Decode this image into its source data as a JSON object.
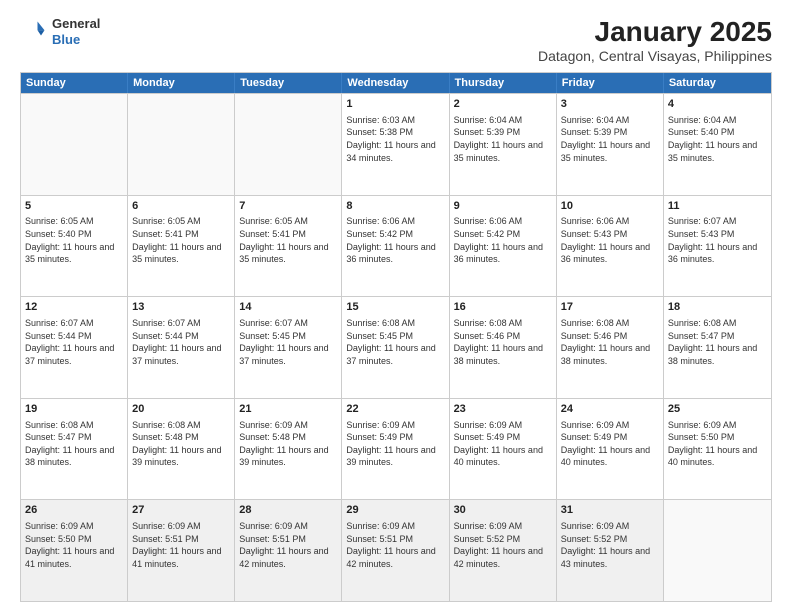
{
  "header": {
    "logo_general": "General",
    "logo_blue": "Blue",
    "title": "January 2025",
    "location": "Datagon, Central Visayas, Philippines"
  },
  "weekdays": [
    "Sunday",
    "Monday",
    "Tuesday",
    "Wednesday",
    "Thursday",
    "Friday",
    "Saturday"
  ],
  "rows": [
    [
      {
        "day": "",
        "empty": true
      },
      {
        "day": "",
        "empty": true
      },
      {
        "day": "",
        "empty": true
      },
      {
        "day": "1",
        "sunrise": "6:03 AM",
        "sunset": "5:38 PM",
        "daylight": "11 hours and 34 minutes."
      },
      {
        "day": "2",
        "sunrise": "6:04 AM",
        "sunset": "5:39 PM",
        "daylight": "11 hours and 35 minutes."
      },
      {
        "day": "3",
        "sunrise": "6:04 AM",
        "sunset": "5:39 PM",
        "daylight": "11 hours and 35 minutes."
      },
      {
        "day": "4",
        "sunrise": "6:04 AM",
        "sunset": "5:40 PM",
        "daylight": "11 hours and 35 minutes."
      }
    ],
    [
      {
        "day": "5",
        "sunrise": "6:05 AM",
        "sunset": "5:40 PM",
        "daylight": "11 hours and 35 minutes."
      },
      {
        "day": "6",
        "sunrise": "6:05 AM",
        "sunset": "5:41 PM",
        "daylight": "11 hours and 35 minutes."
      },
      {
        "day": "7",
        "sunrise": "6:05 AM",
        "sunset": "5:41 PM",
        "daylight": "11 hours and 35 minutes."
      },
      {
        "day": "8",
        "sunrise": "6:06 AM",
        "sunset": "5:42 PM",
        "daylight": "11 hours and 36 minutes."
      },
      {
        "day": "9",
        "sunrise": "6:06 AM",
        "sunset": "5:42 PM",
        "daylight": "11 hours and 36 minutes."
      },
      {
        "day": "10",
        "sunrise": "6:06 AM",
        "sunset": "5:43 PM",
        "daylight": "11 hours and 36 minutes."
      },
      {
        "day": "11",
        "sunrise": "6:07 AM",
        "sunset": "5:43 PM",
        "daylight": "11 hours and 36 minutes."
      }
    ],
    [
      {
        "day": "12",
        "sunrise": "6:07 AM",
        "sunset": "5:44 PM",
        "daylight": "11 hours and 37 minutes."
      },
      {
        "day": "13",
        "sunrise": "6:07 AM",
        "sunset": "5:44 PM",
        "daylight": "11 hours and 37 minutes."
      },
      {
        "day": "14",
        "sunrise": "6:07 AM",
        "sunset": "5:45 PM",
        "daylight": "11 hours and 37 minutes."
      },
      {
        "day": "15",
        "sunrise": "6:08 AM",
        "sunset": "5:45 PM",
        "daylight": "11 hours and 37 minutes."
      },
      {
        "day": "16",
        "sunrise": "6:08 AM",
        "sunset": "5:46 PM",
        "daylight": "11 hours and 38 minutes."
      },
      {
        "day": "17",
        "sunrise": "6:08 AM",
        "sunset": "5:46 PM",
        "daylight": "11 hours and 38 minutes."
      },
      {
        "day": "18",
        "sunrise": "6:08 AM",
        "sunset": "5:47 PM",
        "daylight": "11 hours and 38 minutes."
      }
    ],
    [
      {
        "day": "19",
        "sunrise": "6:08 AM",
        "sunset": "5:47 PM",
        "daylight": "11 hours and 38 minutes."
      },
      {
        "day": "20",
        "sunrise": "6:08 AM",
        "sunset": "5:48 PM",
        "daylight": "11 hours and 39 minutes."
      },
      {
        "day": "21",
        "sunrise": "6:09 AM",
        "sunset": "5:48 PM",
        "daylight": "11 hours and 39 minutes."
      },
      {
        "day": "22",
        "sunrise": "6:09 AM",
        "sunset": "5:49 PM",
        "daylight": "11 hours and 39 minutes."
      },
      {
        "day": "23",
        "sunrise": "6:09 AM",
        "sunset": "5:49 PM",
        "daylight": "11 hours and 40 minutes."
      },
      {
        "day": "24",
        "sunrise": "6:09 AM",
        "sunset": "5:49 PM",
        "daylight": "11 hours and 40 minutes."
      },
      {
        "day": "25",
        "sunrise": "6:09 AM",
        "sunset": "5:50 PM",
        "daylight": "11 hours and 40 minutes."
      }
    ],
    [
      {
        "day": "26",
        "sunrise": "6:09 AM",
        "sunset": "5:50 PM",
        "daylight": "11 hours and 41 minutes."
      },
      {
        "day": "27",
        "sunrise": "6:09 AM",
        "sunset": "5:51 PM",
        "daylight": "11 hours and 41 minutes."
      },
      {
        "day": "28",
        "sunrise": "6:09 AM",
        "sunset": "5:51 PM",
        "daylight": "11 hours and 42 minutes."
      },
      {
        "day": "29",
        "sunrise": "6:09 AM",
        "sunset": "5:51 PM",
        "daylight": "11 hours and 42 minutes."
      },
      {
        "day": "30",
        "sunrise": "6:09 AM",
        "sunset": "5:52 PM",
        "daylight": "11 hours and 42 minutes."
      },
      {
        "day": "31",
        "sunrise": "6:09 AM",
        "sunset": "5:52 PM",
        "daylight": "11 hours and 43 minutes."
      },
      {
        "day": "",
        "empty": true
      }
    ]
  ]
}
